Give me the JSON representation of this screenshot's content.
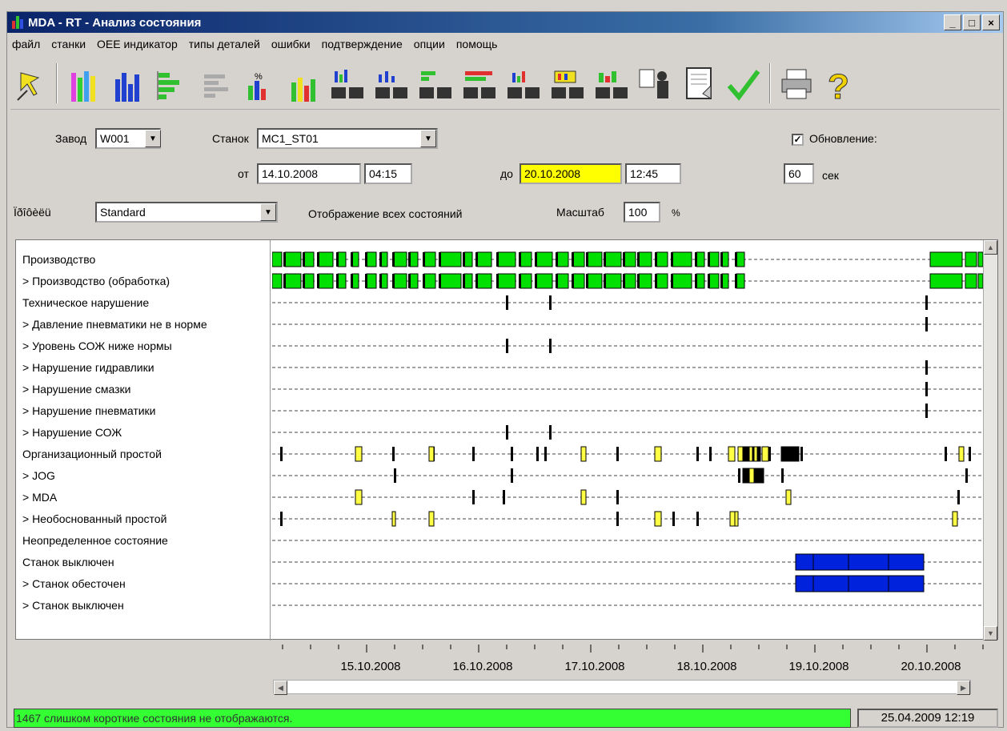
{
  "window": {
    "title": "MDA - RT - Анализ состояния",
    "min_glyph": "_",
    "max_glyph": "□",
    "close_glyph": "×"
  },
  "menu": [
    "файл",
    "станки",
    "ОЕЕ индикатор",
    "типы деталей",
    "ошибки",
    "подтверждение",
    "опции",
    "помощь"
  ],
  "toolbar_icons": [
    "pointer-icon",
    "multicolor-bars-icon",
    "blue-bars-icon",
    "horizontal-bars-icon",
    "gray-bars-icon",
    "percent-bars-icon",
    "yellow-green-bars-icon",
    "machines-report-1-icon",
    "machines-report-2-icon",
    "machines-report-3-icon",
    "machines-report-4-icon",
    "machines-report-5-icon",
    "machines-report-6-icon",
    "machines-report-7-icon",
    "person-board-icon",
    "document-icon",
    "confirm-check-icon",
    "print-icon",
    "help-icon"
  ],
  "filters": {
    "plant_label": "Завод",
    "plant_value": "W001",
    "machine_label": "Станок",
    "machine_value": "MC1_ST01",
    "refresh_label": "Обновление:",
    "refresh_checked": "✓",
    "from_label": "от",
    "from_date": "14.10.2008",
    "from_time": "04:15",
    "to_label": "до",
    "to_date": "20.10.2008",
    "to_time": "12:45",
    "refresh_interval": "60",
    "refresh_unit": "сек",
    "profile_label": "Ïðîôèëü",
    "profile_value": "Standard",
    "display_text": "Отображение всех состояний",
    "scale_label": "Масштаб",
    "scale_value": "100",
    "scale_unit": "%",
    "colors": {
      "highlight_date": "#ffff00"
    }
  },
  "rows": [
    "Производство",
    "> Производство (обработка)",
    "Техническое нарушение",
    "> Давление пневматики не в норме",
    "> Уровень СОЖ ниже нормы",
    "> Нарушение гидравлики",
    "> Нарушение смазки",
    "> Нарушение пневматики",
    "> Нарушение СОЖ",
    "Организационный простой",
    "> JOG",
    "> MDA",
    "> Необоснованный простой",
    "Неопределенное состояние",
    "Станок выключен",
    "> Станок обесточен",
    "> Станок выключен"
  ],
  "timeline": {
    "dates": [
      "15.10.2008",
      "16.10.2008",
      "17.10.2008",
      "18.10.2008",
      "19.10.2008",
      "20.10.2008"
    ],
    "colors": {
      "production": "#00e000",
      "idle": "#ffff44",
      "off": "#0022dd",
      "fault": "#000000"
    }
  },
  "status": {
    "message": "1467 слишком короткие состояния не отображаются.",
    "datetime": "25.04.2009 12:19",
    "color": "#33ff33"
  }
}
